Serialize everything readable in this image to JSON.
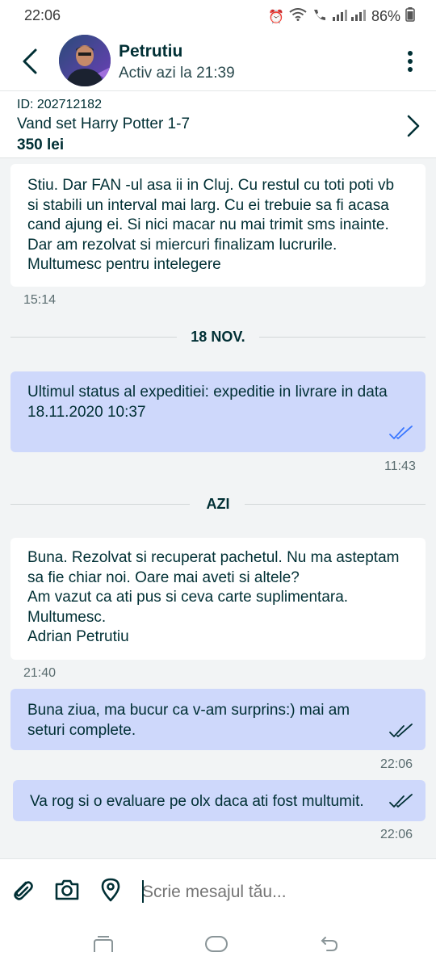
{
  "status_bar": {
    "time": "22:06",
    "battery": "86%",
    "icons": [
      "alarm-icon",
      "wifi-icon",
      "call-icon",
      "signal-icon"
    ]
  },
  "header": {
    "name": "Petrutiu",
    "status": "Activ azi la 21:39"
  },
  "listing": {
    "id": "ID: 202712182",
    "title": "Vand set Harry Potter 1-7",
    "price": "350 lei"
  },
  "messages": [
    {
      "dir": "in",
      "text": "Stiu. Dar FAN -ul asa ii in Cluj. Cu restul cu toti poti vb si stabili un interval mai larg. Cu ei trebuie sa fi acasa cand ajung ei. Si nici macar nu mai trimit sms inainte. Dar am rezolvat si miercuri finalizam lucrurile. Multumesc pentru intelegere",
      "time": "15:14"
    },
    {
      "dir": "out",
      "text": "Ultimul status al expeditiei: expeditie in livrare in data\n18.11.2020 10:37",
      "time": "11:43"
    },
    {
      "dir": "in",
      "text": "Buna. Rezolvat si recuperat pachetul. Nu ma asteptam sa fie chiar noi. Oare mai aveti si altele?\nAm vazut ca ati pus si ceva carte suplimentara.\nMultumesc.\nAdrian Petrutiu",
      "time": "21:40"
    },
    {
      "dir": "out",
      "text": "Buna ziua, ma bucur ca v-am surprins:) mai am seturi complete.",
      "time": "22:06"
    },
    {
      "dir": "out",
      "text": "Va rog si o evaluare pe olx daca ati fost multumit.",
      "time": "22:06"
    }
  ],
  "dividers": [
    "18 NOV.",
    "AZI"
  ],
  "composer": {
    "placeholder": "Scrie mesajul tău..."
  },
  "colors": {
    "outgoing_bubble": "#ced8fb",
    "incoming_bubble": "#ffffff",
    "text_primary": "#002f34",
    "background": "#f2f4f5",
    "tick": "#3a77ff"
  }
}
